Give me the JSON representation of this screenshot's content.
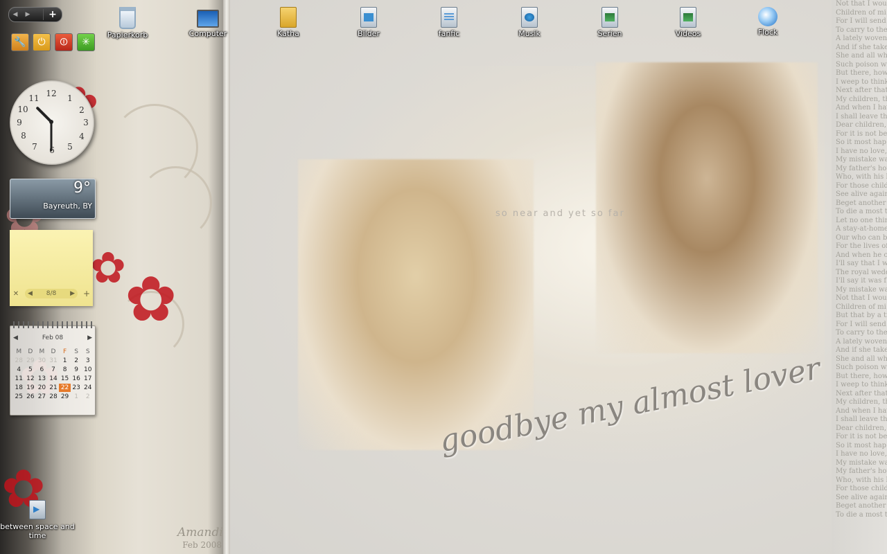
{
  "desktop_icons": [
    {
      "label": "Papierkorb",
      "icon": "recycle-bin-icon"
    },
    {
      "label": "Computer",
      "icon": "computer-icon"
    },
    {
      "label": "Katha",
      "icon": "user-folder-icon"
    },
    {
      "label": "Bilder",
      "icon": "pictures-library-icon"
    },
    {
      "label": "fanfic",
      "icon": "documents-library-icon"
    },
    {
      "label": "Musik",
      "icon": "music-library-icon"
    },
    {
      "label": "Serien",
      "icon": "video-library-icon"
    },
    {
      "label": "Videos",
      "icon": "video-library-icon"
    },
    {
      "label": "Flock",
      "icon": "flock-browser-icon"
    }
  ],
  "sidebar": {
    "controls": {
      "prev": "◀",
      "next": "▶",
      "add": "+"
    },
    "quick_buttons": [
      {
        "name": "tools",
        "glyph": "🔧"
      },
      {
        "name": "sleep",
        "glyph": "⏻"
      },
      {
        "name": "shutdown",
        "glyph": "⏼"
      },
      {
        "name": "green",
        "glyph": "✳"
      }
    ],
    "clock": {
      "hour": 10,
      "minute": 30
    },
    "weather": {
      "temperature": "9°",
      "location": "Bayreuth, BY"
    },
    "notes": {
      "close": "✕",
      "prev": "◀",
      "pager": "8/8",
      "next": "▶",
      "add": "+"
    },
    "calendar": {
      "month": "Feb 08",
      "prev": "◀",
      "next": "▶",
      "weekdays": [
        "M",
        "D",
        "M",
        "D",
        "F",
        "S",
        "S"
      ],
      "days": [
        "28",
        "29",
        "30",
        "31",
        "1",
        "2",
        "3",
        "4",
        "5",
        "6",
        "7",
        "8",
        "9",
        "10",
        "11",
        "12",
        "13",
        "14",
        "15",
        "16",
        "17",
        "18",
        "19",
        "20",
        "21",
        "22",
        "23",
        "24",
        "25",
        "26",
        "27",
        "28",
        "29",
        "1",
        "2"
      ],
      "muted_leading": 4,
      "muted_trailing": 2,
      "today": "22"
    }
  },
  "desktop_shortcut": {
    "label": "between space and time"
  },
  "wallpaper": {
    "tagline": "so near and yet so far",
    "script_caption": "goodbye my almost lover",
    "artist_signature": "Amandi",
    "artist_date": "Feb 2008",
    "text_column_lines": [
      "Not that I would",
      "Children of mi",
      "For I will send th",
      "To carry to the",
      "A lately woven",
      "And if she takes",
      "She and all who",
      "Such poison will",
      "But there, howe",
      "I weep to think",
      "Next after that;",
      "My children, th",
      "And when I have",
      "I shall leave the",
      "Dear children,",
      "For it is not bea",
      "So it most hap",
      "I have no love, n",
      "My mistake was",
      "My father's hou",
      "Who, with his h",
      "For those childre",
      "See alive again",
      "Beget another c",
      "To die a most to",
      "Let no one think",
      "A stay-at-home",
      "Our who can be",
      "For the lives of",
      "And when he co",
      "I'll say that I w",
      "The royal wedd",
      "I'll say it was f",
      "My mistake was",
      "Not that I would",
      "Children of mi",
      "But that by a tr",
      "For I will send th",
      "To carry to the",
      "A lately woven",
      "And if she takes",
      "She and all who",
      "Such poison wi",
      "But there, how",
      "I weep to think",
      "Next after that;",
      "My children, th",
      "And when I have",
      "I shall leave the",
      "Dear children,",
      "For it is not bea",
      "So it most hap",
      "I have no love,",
      "My mistake wa",
      "My father's hou",
      "Who, with his h",
      "For those childr",
      "See alive again",
      "Beget another c",
      "To die a most to"
    ]
  },
  "colors": {
    "accent_orange": "#e67a2a",
    "flower_red": "#c0141c",
    "note_yellow": "#fbf3b3"
  }
}
